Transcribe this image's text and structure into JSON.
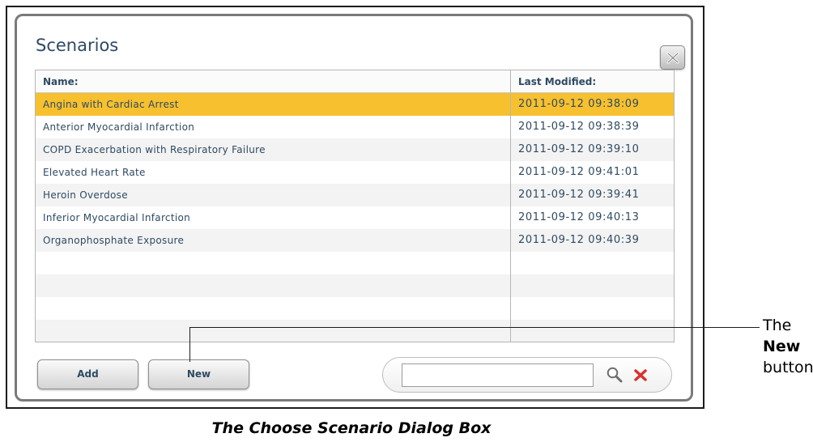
{
  "dialog": {
    "title": "Scenarios",
    "columns": {
      "name": "Name:",
      "modified": "Last Modified:"
    },
    "rows": [
      {
        "name": "Angina with Cardiac Arrest",
        "modified": "2011-09-12 09:38:09",
        "selected": true
      },
      {
        "name": "Anterior Myocardial Infarction",
        "modified": "2011-09-12 09:38:39"
      },
      {
        "name": "COPD Exacerbation with Respiratory Failure",
        "modified": "2011-09-12 09:39:10"
      },
      {
        "name": "Elevated Heart Rate",
        "modified": "2011-09-12 09:41:01"
      },
      {
        "name": "Heroin Overdose",
        "modified": "2011-09-12 09:39:41"
      },
      {
        "name": "Inferior Myocardial Infarction",
        "modified": "2011-09-12 09:40:13"
      },
      {
        "name": "Organophosphate Exposure",
        "modified": "2011-09-12 09:40:39"
      }
    ],
    "buttons": {
      "add": "Add",
      "new": "New"
    },
    "search": {
      "value": "",
      "placeholder": ""
    },
    "icons": {
      "close": "close-icon",
      "search": "search-icon",
      "clear": "clear-icon"
    }
  },
  "callout": {
    "prefix": "The",
    "bold": "New",
    "suffix": "button"
  },
  "caption": "The Choose Scenario Dialog Box",
  "colors": {
    "selected_row": "#f7c02e",
    "text": "#2e4a63",
    "clear_icon": "#d9322c"
  }
}
